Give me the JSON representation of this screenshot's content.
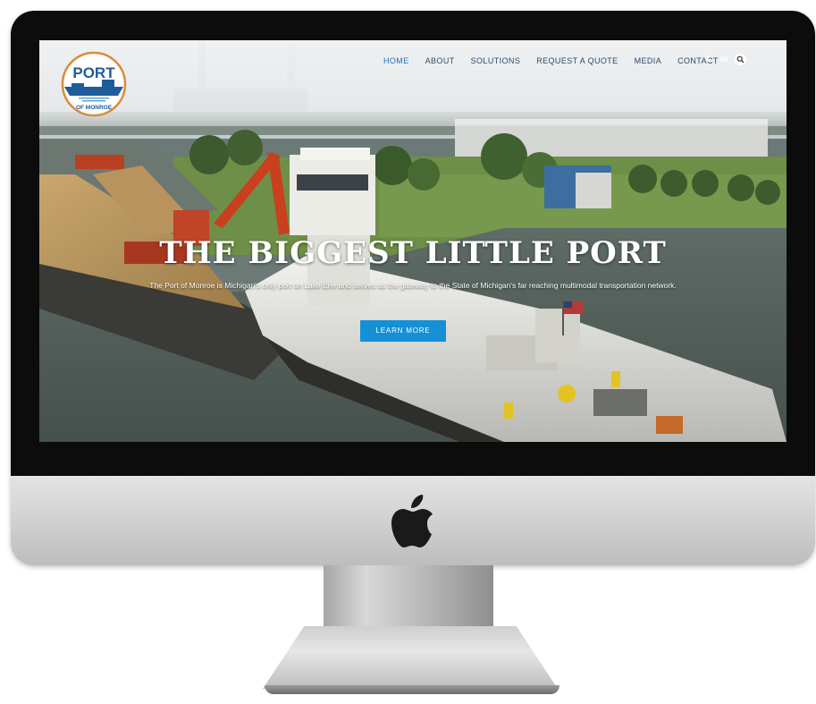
{
  "site": {
    "logo": {
      "line1": "PORT",
      "line2": "OF MONROE"
    },
    "nav": {
      "items": [
        {
          "label": "HOME",
          "active": true
        },
        {
          "label": "ABOUT",
          "active": false
        },
        {
          "label": "SOLUTIONS",
          "active": false
        },
        {
          "label": "REQUEST A QUOTE",
          "active": false
        },
        {
          "label": "MEDIA",
          "active": false
        },
        {
          "label": "CONTACT",
          "active": false
        }
      ],
      "social": {
        "facebook": "f",
        "linkedin": "in"
      },
      "search_icon": "search-icon"
    },
    "hero": {
      "title": "THE BIGGEST LITTLE PORT",
      "subtitle": "The Port of Monroe is Michigan's only port on Lake Erie and serves as the gateway to the State of Michigan's far reaching multimodal transportation network.",
      "button_label": "LEARN MORE"
    }
  },
  "device": {
    "brand_icon": "apple-logo-icon"
  },
  "colors": {
    "accent_blue": "#1590d6",
    "nav_text": "#2a4a6a",
    "logo_blue": "#1f5c9a",
    "logo_ring": "#d98b3a"
  }
}
